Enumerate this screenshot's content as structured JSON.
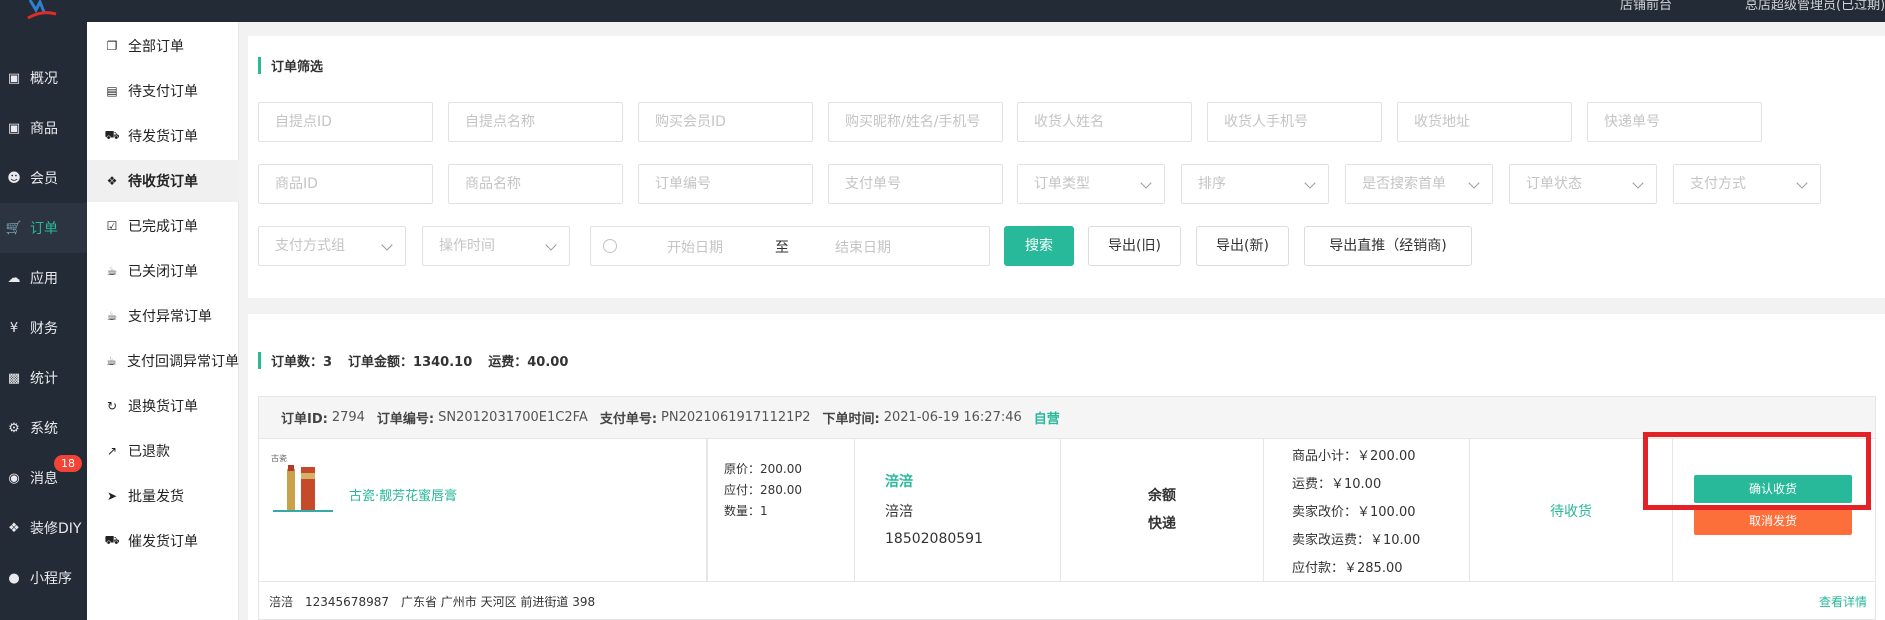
{
  "header": {
    "right_item_1": "店铺前台",
    "right_item_2": "总店超级管理员(已过期)"
  },
  "sidebar": {
    "items": [
      {
        "label": "概况",
        "icon": "archive-icon"
      },
      {
        "label": "商品",
        "icon": "box-icon"
      },
      {
        "label": "会员",
        "icon": "users-icon"
      },
      {
        "label": "订单",
        "icon": "cart-icon"
      },
      {
        "label": "应用",
        "icon": "apps-icon"
      },
      {
        "label": "财务",
        "icon": "yen-icon"
      },
      {
        "label": "统计",
        "icon": "chart-icon"
      },
      {
        "label": "系统",
        "icon": "gears-icon"
      },
      {
        "label": "消息",
        "icon": "message-icon"
      },
      {
        "label": "装修DIY",
        "icon": "hammer-icon"
      },
      {
        "label": "小程序",
        "icon": "wechat-icon"
      }
    ],
    "message_badge": "18"
  },
  "subnav": {
    "items": [
      {
        "label": "全部订单",
        "icon": "copy-icon"
      },
      {
        "label": "待支付订单",
        "icon": "card-icon"
      },
      {
        "label": "待发货订单",
        "icon": "truck-icon"
      },
      {
        "label": "待收货订单",
        "icon": "dropbox-icon"
      },
      {
        "label": "已完成订单",
        "icon": "check-square-icon"
      },
      {
        "label": "已关闭订单",
        "icon": "cup-icon"
      },
      {
        "label": "支付异常订单",
        "icon": "cup-icon"
      },
      {
        "label": "支付回调异常订单",
        "icon": "cup-icon"
      },
      {
        "label": "退换货订单",
        "icon": "refresh-icon"
      },
      {
        "label": "已退款",
        "icon": "export-icon"
      },
      {
        "label": "批量发货",
        "icon": "send-icon"
      },
      {
        "label": "催发货订单",
        "icon": "truck-icon"
      }
    ]
  },
  "filter": {
    "title": "订单筛选",
    "fields_row1": [
      "自提点ID",
      "自提点名称",
      "购买会员ID",
      "购买昵称/姓名/手机号",
      "收货人姓名",
      "收货人手机号",
      "收货地址",
      "快递单号"
    ],
    "fields_row2": [
      "商品ID",
      "商品名称",
      "订单编号",
      "支付单号"
    ],
    "selects_row2": [
      "订单类型",
      "排序",
      "是否搜索首单",
      "订单状态",
      "支付方式"
    ],
    "selects_row3": [
      "支付方式组",
      "操作时间"
    ],
    "date_start": "开始日期",
    "date_to": "至",
    "date_end": "结束日期",
    "search_button": "搜索",
    "export_old": "导出(旧)",
    "export_new": "导出(新)",
    "export_direct": "导出直推（经销商)"
  },
  "stats": {
    "count": "订单数：3",
    "amount": "订单金额：1340.10",
    "freight": "运费：40.00"
  },
  "order": {
    "id_label": "订单ID:",
    "id": "2794",
    "no_label": "订单编号:",
    "no": "SN2012031700E1C2FA",
    "pay_label": "支付单号:",
    "pay_no": "PN20210619171121P2",
    "time_label": "下单时间:",
    "time": "2021-06-19 16:27:46",
    "tag": "自营",
    "product_name": "古瓷·靓芳花蜜唇膏",
    "original_price": "原价：200.00",
    "payable": "应付：280.00",
    "quantity": "数量：1",
    "buyer_nick": "涪涪",
    "buyer_name": "涪涪",
    "buyer_phone": "18502080591",
    "pay_method": "余额",
    "ship_method": "快递",
    "subtotal": "商品小计：￥200.00",
    "freight": "运费：￥10.00",
    "seller_price": "卖家改价：￥100.00",
    "seller_freight": "卖家改运费：￥10.00",
    "total": "应付款：￥285.00",
    "status": "待收货",
    "confirm_button": "确认收货",
    "cancel_button": "取消发货",
    "address": "涪涪　12345678987　广东省 广州市 天河区 前进街道 398",
    "detail_link": "查看详情"
  }
}
